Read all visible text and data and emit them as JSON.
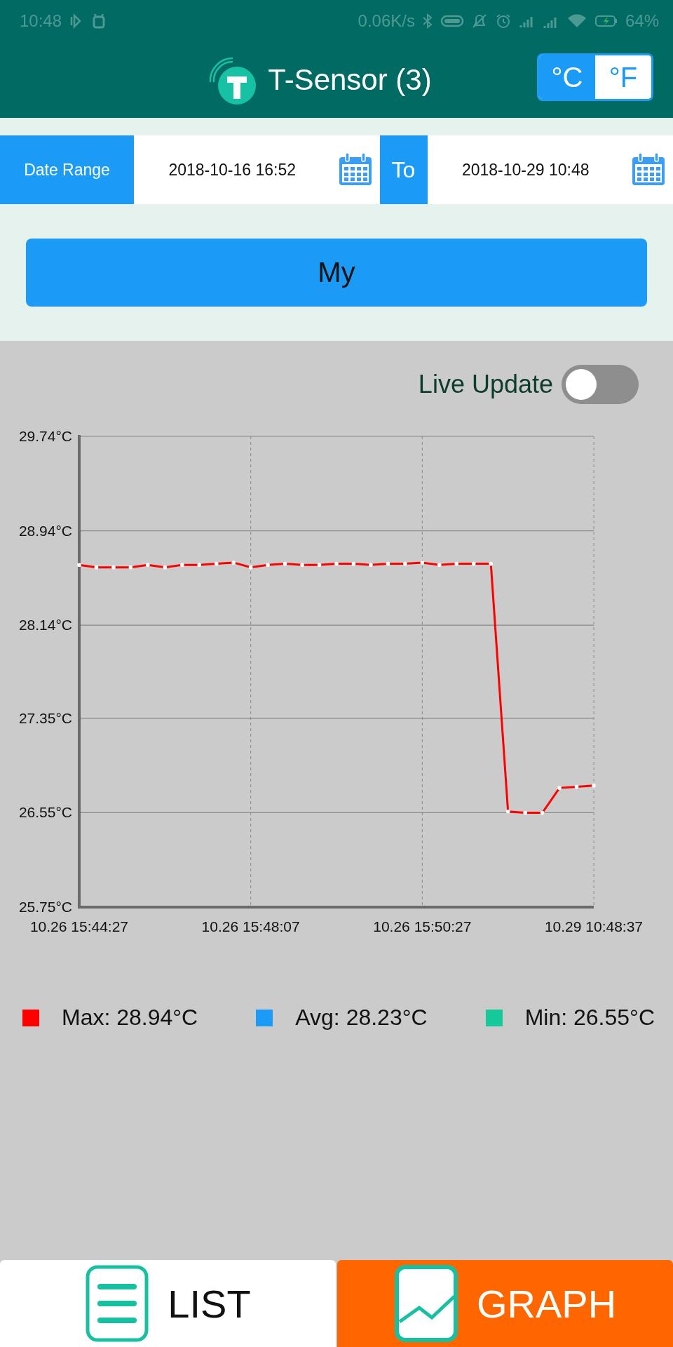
{
  "status_bar": {
    "time": "10:48",
    "speed": "0.06K/s",
    "battery": "64%"
  },
  "header": {
    "title": "T-Sensor (3)",
    "units": [
      {
        "label": "°C",
        "selected": true
      },
      {
        "label": "°F",
        "selected": false
      }
    ]
  },
  "date_range": {
    "label": "Date Range",
    "from": "2018-10-16 16:52",
    "separator": "To",
    "to": "2018-10-29 10:48"
  },
  "device_button": "My",
  "live_update": {
    "label": "Live Update",
    "on": false
  },
  "chart_data": {
    "type": "line",
    "categories": [
      "10.26 15:44:27",
      null,
      null,
      null,
      null,
      null,
      null,
      null,
      null,
      null,
      "10.26 15:48:07",
      null,
      null,
      null,
      null,
      null,
      null,
      null,
      null,
      null,
      "10.26 15:50:27",
      null,
      null,
      null,
      null,
      null,
      null,
      null,
      null,
      null,
      "10.29 10:48:37"
    ],
    "series": [
      {
        "color": "#ff0000",
        "values": [
          28.65,
          28.63,
          28.63,
          28.63,
          28.65,
          28.63,
          28.65,
          28.65,
          28.66,
          28.67,
          28.63,
          28.65,
          28.66,
          28.65,
          28.65,
          28.66,
          28.66,
          28.65,
          28.66,
          28.66,
          28.67,
          28.65,
          28.66,
          28.66,
          28.66,
          26.56,
          26.55,
          26.55,
          26.76,
          26.77,
          26.78
        ]
      }
    ],
    "ylim": [
      25.75,
      29.74
    ],
    "grid": true,
    "yticks": [
      {
        "value": 25.75,
        "label": "25.75°C"
      },
      {
        "value": 26.55,
        "label": "26.55°C"
      },
      {
        "value": 27.35,
        "label": "27.35°C"
      },
      {
        "value": 28.14,
        "label": "28.14°C"
      },
      {
        "value": 28.94,
        "label": "28.94°C"
      },
      {
        "value": 29.74,
        "label": "29.74°C"
      }
    ]
  },
  "legend": [
    {
      "label": "Max: 28.94°C",
      "color": "#ff0000"
    },
    {
      "label": "Avg: 28.23°C",
      "color": "#1b9bf5"
    },
    {
      "label": "Min: 26.55°C",
      "color": "#16c99a"
    }
  ],
  "tabs": [
    {
      "kind": "list",
      "label": "LIST",
      "selected": false
    },
    {
      "kind": "graph",
      "label": "GRAPH",
      "selected": true
    }
  ]
}
